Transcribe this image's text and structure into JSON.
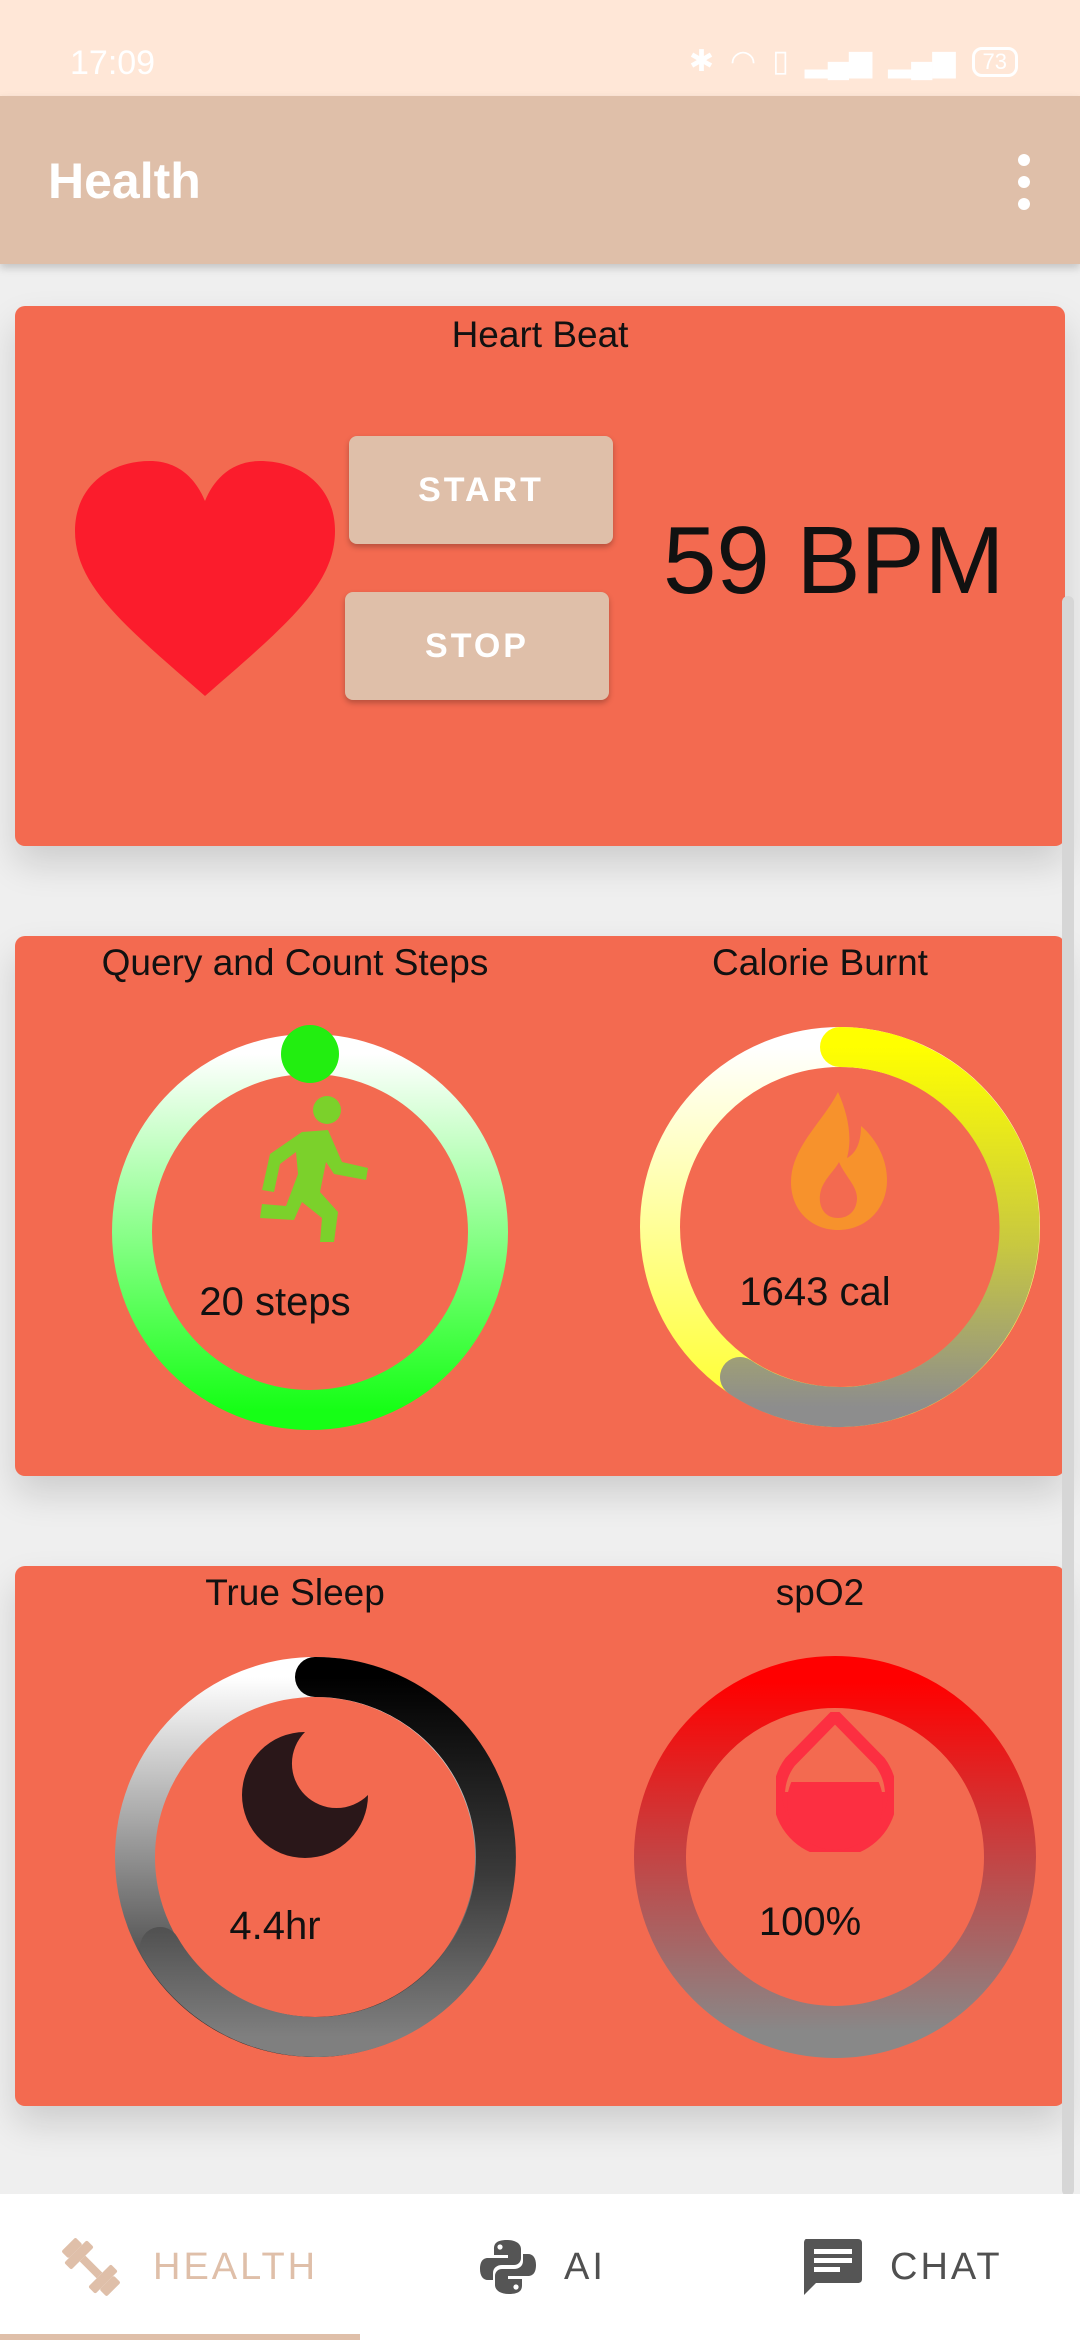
{
  "status_bar": {
    "time": "17:09",
    "battery": "73"
  },
  "app_bar": {
    "title": "Health"
  },
  "heart_beat": {
    "title": "Heart Beat",
    "start_label": "START",
    "stop_label": "STOP",
    "bpm_text": "59 BPM"
  },
  "steps": {
    "title": "Query and Count Steps",
    "value_text": "20 steps",
    "icon": "running-person-icon"
  },
  "calories": {
    "title": "Calorie Burnt",
    "value_text": "1643 cal",
    "icon": "flame-icon"
  },
  "sleep": {
    "title": "True Sleep",
    "value_text": "4.4hr",
    "icon": "moon-icon"
  },
  "spo2": {
    "title": "spO2",
    "value_text": "100%",
    "icon": "drop-icon"
  },
  "bottom_nav": {
    "items": [
      {
        "label": "HEALTH",
        "icon": "dumbbell-icon",
        "selected": true
      },
      {
        "label": "AI",
        "icon": "python-icon",
        "selected": false
      },
      {
        "label": "CHAT",
        "icon": "chat-icon",
        "selected": false
      }
    ]
  },
  "colors": {
    "card": "#f36a50",
    "app_bar": "#dfbfa9",
    "status_bar": "#ffe7d7",
    "heart": "#fb1c2c",
    "steps_ring": "#17ff17",
    "calorie_ring": "#ffff00",
    "spo2_ring": "#fd0000"
  }
}
